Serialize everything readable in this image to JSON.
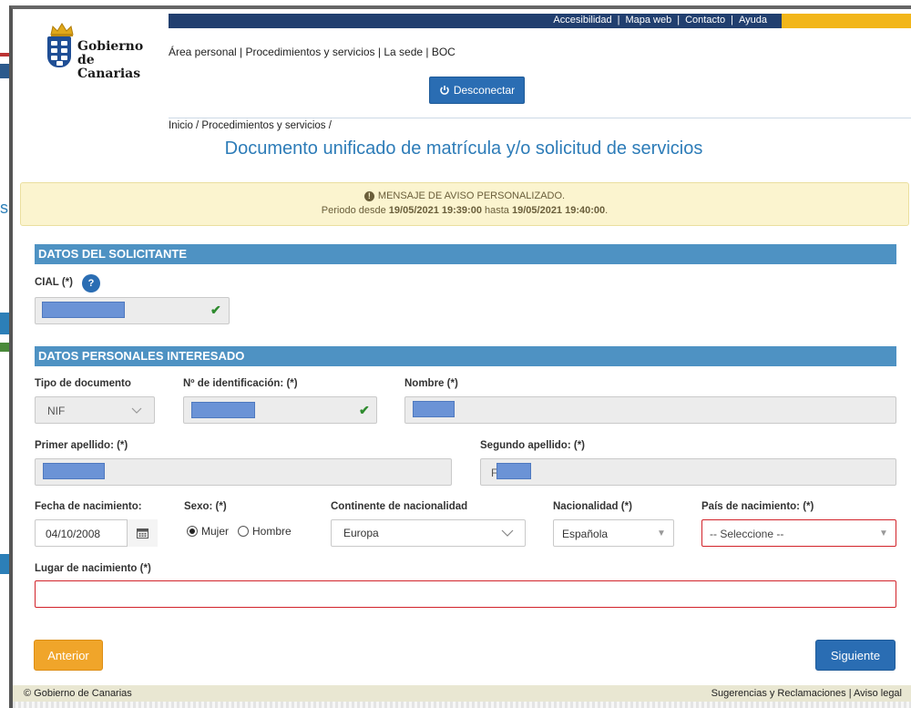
{
  "topnav": {
    "links": [
      "Accesibilidad",
      "Mapa web",
      "Contacto",
      "Ayuda"
    ]
  },
  "brand": {
    "line1": "Gobierno",
    "line2": "de Canarias"
  },
  "sitelinks": "Área personal | Procedimientos y servicios | La sede | BOC",
  "disconnect_label": "Desconectar",
  "breadcrumb": "Inicio / Procedimientos y servicios /",
  "page_title": "Documento unificado de matrícula y/o solicitud de servicios",
  "notice": {
    "title": "MENSAJE DE AVISO PERSONALIZADO.",
    "prefix": "Periodo desde",
    "from": "19/05/2021 19:39:00",
    "middle": "hasta",
    "to": "19/05/2021 19:40:00",
    "suffix": "."
  },
  "solicitante": {
    "section_title": "DATOS DEL SOLICITANTE",
    "cial_label": "CIAL (*)"
  },
  "interesado": {
    "section_title": "DATOS PERSONALES INTERESADO",
    "tipo_doc_label": "Tipo de documento",
    "tipo_doc_value": "NIF",
    "num_id_label": "Nº de identificación: (*)",
    "nombre_label": "Nombre (*)",
    "apellido1_label": "Primer apellido: (*)",
    "apellido2_label": "Segundo apellido: (*)",
    "apellido2_prefix": "F",
    "fecha_label": "Fecha de nacimiento:",
    "fecha_value": "04/10/2008",
    "sexo_label": "Sexo: (*)",
    "sexo_options": [
      "Mujer",
      "Hombre"
    ],
    "sexo_selected": "Mujer",
    "continente_label": "Continente de nacionalidad",
    "continente_value": "Europa",
    "nacionalidad_label": "Nacionalidad (*)",
    "nacionalidad_value": "Española",
    "pais_label": "País de nacimiento: (*)",
    "pais_placeholder": "-- Seleccione --",
    "lugar_label": "Lugar de nacimiento (*)"
  },
  "buttons": {
    "prev": "Anterior",
    "next": "Siguiente"
  },
  "footer": {
    "copyright": "© Gobierno de Canarias",
    "links": "Sugerencias y Reclamaciones | Aviso legal"
  },
  "colors": {
    "primary": "#2a6db3",
    "section": "#4e92c3",
    "title": "#2d7cb8",
    "accent": "#f0a52a",
    "error": "#d2232a",
    "notice_bg": "#fbf4cf"
  },
  "icons": [
    "power-icon",
    "help-icon",
    "check-icon",
    "calendar-icon",
    "chevron-down-icon",
    "warning-icon"
  ]
}
